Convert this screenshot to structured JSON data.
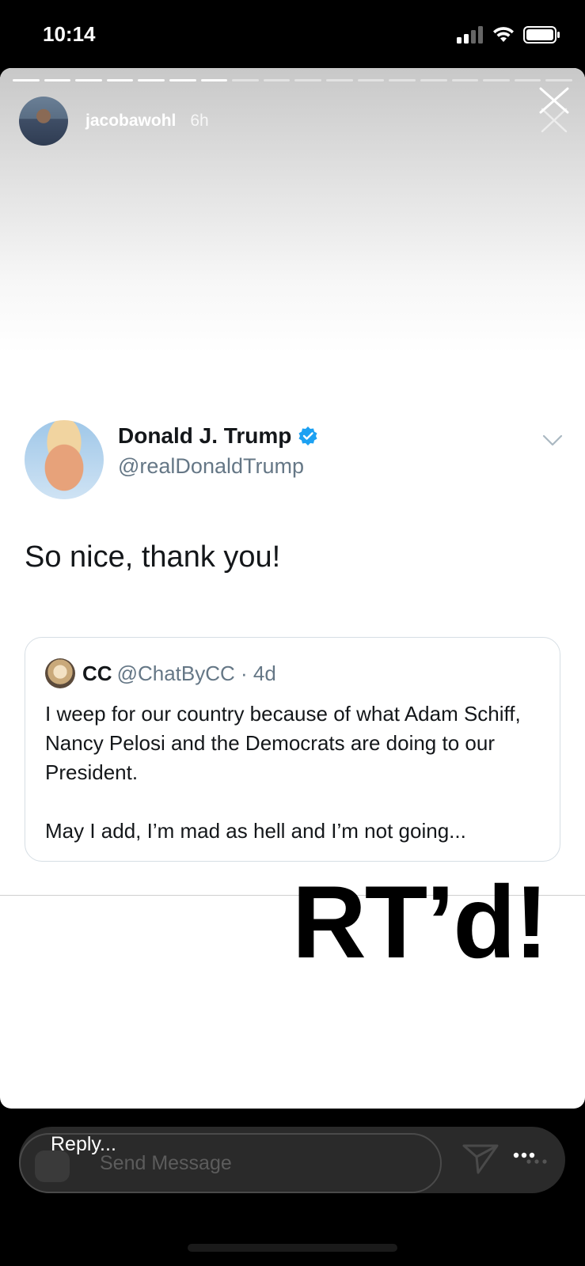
{
  "status_bar": {
    "time": "10:14",
    "icons": [
      "cellular-signal-icon",
      "wifi-icon",
      "battery-icon"
    ]
  },
  "story": {
    "username": "jacobawohl",
    "time_ago": "6h",
    "progress": {
      "segments": 18,
      "completed": 7
    },
    "close_icon": "close-icon"
  },
  "tweet": {
    "author_name": "Donald J. Trump",
    "author_handle": "@realDonaldTrump",
    "text": "So nice, thank you!",
    "quote": {
      "name": "CC",
      "handle_meta": "@ChatByCC · 4d",
      "paragraph1": "I weep for our country because of what Adam Schiff, Nancy Pelosi and the Democrats are doing to our President.",
      "paragraph2": "May I add, I’m mad as hell and I’m not going..."
    }
  },
  "caption": "RT’d!",
  "reply_bar": {
    "ghost_placeholder": "Send Message",
    "label": "Reply..."
  },
  "colors": {
    "twitter_blue": "#1DA1F2",
    "handle_gray": "#657786",
    "text_dark": "#14171a"
  }
}
